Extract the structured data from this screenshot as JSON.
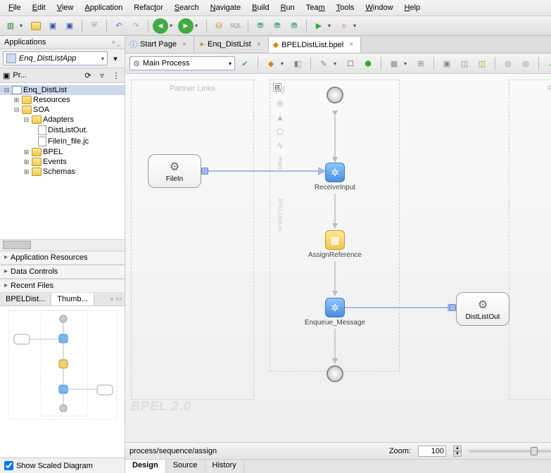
{
  "menu": [
    "File",
    "Edit",
    "View",
    "Application",
    "Refactor",
    "Search",
    "Navigate",
    "Build",
    "Run",
    "Team",
    "Tools",
    "Window",
    "Help"
  ],
  "applications": {
    "panel_title": "Applications",
    "selected_app": "Enq_DistListApp",
    "proj_tab": "Pr...",
    "tree": {
      "root": "Enq_DistList",
      "resources": "Resources",
      "soa": "SOA",
      "adapters": "Adapters",
      "adapter_file1": "DistListOut.",
      "adapter_file2": "FileIn_file.jc",
      "bpel": "BPEL",
      "events": "Events",
      "schemas": "Schemas"
    },
    "sections": [
      "Application Resources",
      "Data Controls",
      "Recent Files"
    ],
    "thumb_tab1": "BPELDist...",
    "thumb_tab2": "Thumb...",
    "show_scaled": "Show Scaled Diagram"
  },
  "editor": {
    "tabs": [
      "Start Page",
      "Enq_DistList",
      "BPELDistList.bpel"
    ],
    "active_tab": 2,
    "process_selector": "Main Process",
    "lane_title": "Partner Links",
    "palette_label": "main",
    "palette_label2": "BPELDistList",
    "nodes": {
      "filein": "FileIn",
      "receive": "ReceiveInput",
      "assign": "AssignReference",
      "enqueue": "Enqueue_Message",
      "distout": "DistListOut"
    },
    "bpel_version": "BPEL 2.0",
    "breadcrumb": "process/sequence/assign",
    "zoom_label": "Zoom:",
    "zoom_value": "100",
    "view_tabs": [
      "Design",
      "Source",
      "History"
    ]
  },
  "collapse_btn": "⊟"
}
